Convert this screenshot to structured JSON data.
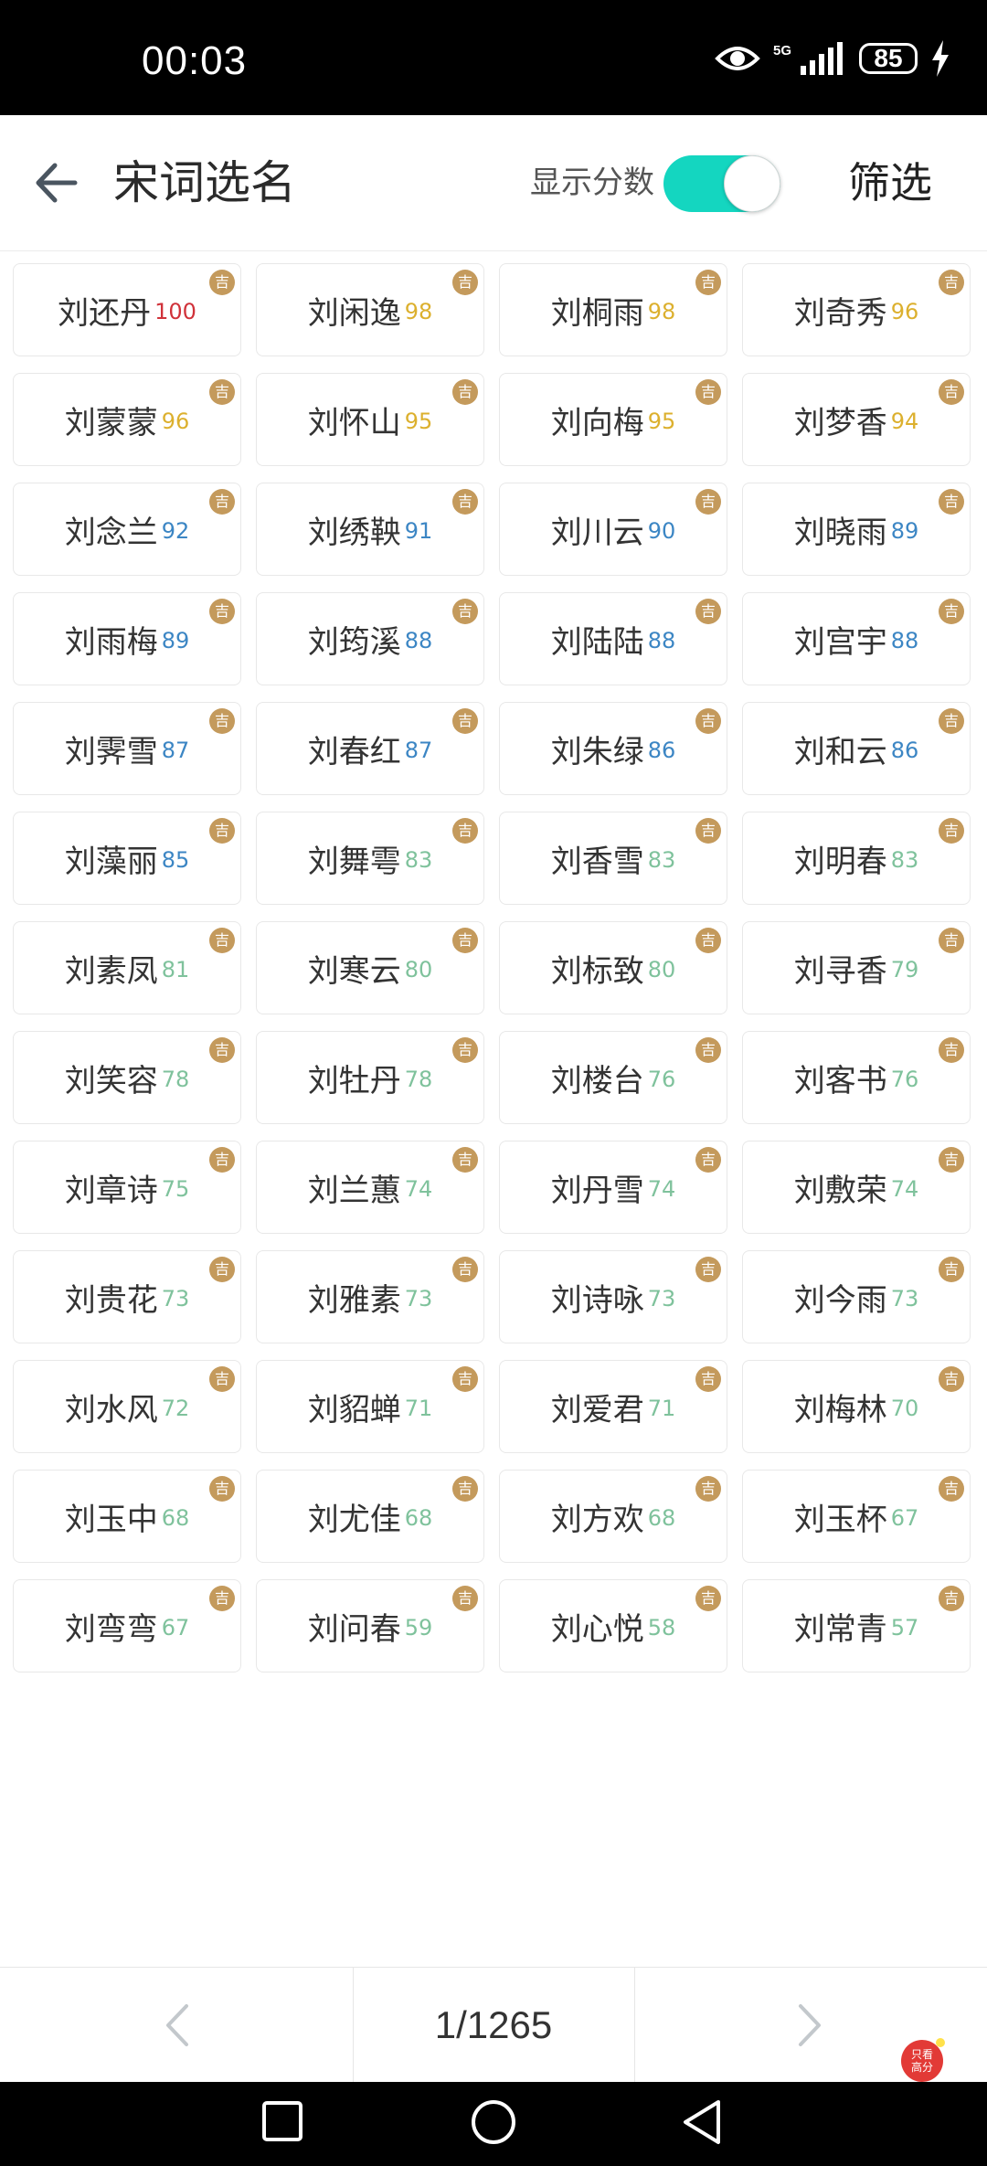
{
  "status_bar": {
    "time": "00:03",
    "network": "5G",
    "battery": "85"
  },
  "header": {
    "title": "宋词选名",
    "toggle_label": "显示分数",
    "toggle_on": true,
    "filter_label": "筛选"
  },
  "badge_text": "吉",
  "colors": {
    "accent_toggle": "#14d6c0",
    "score_red": "#d0323a",
    "score_gold": "#dcb02e",
    "score_blue": "#3c86c4",
    "score_green": "#7fc29c",
    "badge": "#c49a5c"
  },
  "names": [
    {
      "name": "刘还丹",
      "score": "100",
      "tier": "red"
    },
    {
      "name": "刘闲逸",
      "score": "98",
      "tier": "gold"
    },
    {
      "name": "刘桐雨",
      "score": "98",
      "tier": "gold"
    },
    {
      "name": "刘奇秀",
      "score": "96",
      "tier": "gold"
    },
    {
      "name": "刘蒙蒙",
      "score": "96",
      "tier": "gold"
    },
    {
      "name": "刘怀山",
      "score": "95",
      "tier": "gold"
    },
    {
      "name": "刘向梅",
      "score": "95",
      "tier": "gold"
    },
    {
      "name": "刘梦香",
      "score": "94",
      "tier": "gold"
    },
    {
      "name": "刘念兰",
      "score": "92",
      "tier": "blue"
    },
    {
      "name": "刘绣鞅",
      "score": "91",
      "tier": "blue"
    },
    {
      "name": "刘川云",
      "score": "90",
      "tier": "blue"
    },
    {
      "name": "刘晓雨",
      "score": "89",
      "tier": "blue"
    },
    {
      "name": "刘雨梅",
      "score": "89",
      "tier": "blue"
    },
    {
      "name": "刘筠溪",
      "score": "88",
      "tier": "blue"
    },
    {
      "name": "刘陆陆",
      "score": "88",
      "tier": "blue"
    },
    {
      "name": "刘宫宇",
      "score": "88",
      "tier": "blue"
    },
    {
      "name": "刘霁雪",
      "score": "87",
      "tier": "blue"
    },
    {
      "name": "刘春红",
      "score": "87",
      "tier": "blue"
    },
    {
      "name": "刘朱绿",
      "score": "86",
      "tier": "blue"
    },
    {
      "name": "刘和云",
      "score": "86",
      "tier": "blue"
    },
    {
      "name": "刘藻丽",
      "score": "85",
      "tier": "blue"
    },
    {
      "name": "刘舞雩",
      "score": "83",
      "tier": "green"
    },
    {
      "name": "刘香雪",
      "score": "83",
      "tier": "green"
    },
    {
      "name": "刘明春",
      "score": "83",
      "tier": "green"
    },
    {
      "name": "刘素凤",
      "score": "81",
      "tier": "green"
    },
    {
      "name": "刘寒云",
      "score": "80",
      "tier": "green"
    },
    {
      "name": "刘标致",
      "score": "80",
      "tier": "green"
    },
    {
      "name": "刘寻香",
      "score": "79",
      "tier": "green"
    },
    {
      "name": "刘笑容",
      "score": "78",
      "tier": "green"
    },
    {
      "name": "刘牡丹",
      "score": "78",
      "tier": "green"
    },
    {
      "name": "刘楼台",
      "score": "76",
      "tier": "green"
    },
    {
      "name": "刘客书",
      "score": "76",
      "tier": "green"
    },
    {
      "name": "刘章诗",
      "score": "75",
      "tier": "green"
    },
    {
      "name": "刘兰蕙",
      "score": "74",
      "tier": "green"
    },
    {
      "name": "刘丹雪",
      "score": "74",
      "tier": "green"
    },
    {
      "name": "刘敷荣",
      "score": "74",
      "tier": "green"
    },
    {
      "name": "刘贵花",
      "score": "73",
      "tier": "green"
    },
    {
      "name": "刘雅素",
      "score": "73",
      "tier": "green"
    },
    {
      "name": "刘诗咏",
      "score": "73",
      "tier": "green"
    },
    {
      "name": "刘今雨",
      "score": "73",
      "tier": "green"
    },
    {
      "name": "刘水风",
      "score": "72",
      "tier": "green"
    },
    {
      "name": "刘貂蝉",
      "score": "71",
      "tier": "green"
    },
    {
      "name": "刘爱君",
      "score": "71",
      "tier": "green"
    },
    {
      "name": "刘梅林",
      "score": "70",
      "tier": "green"
    },
    {
      "name": "刘玉中",
      "score": "68",
      "tier": "green"
    },
    {
      "name": "刘尤佳",
      "score": "68",
      "tier": "green"
    },
    {
      "name": "刘方欢",
      "score": "68",
      "tier": "green"
    },
    {
      "name": "刘玉杯",
      "score": "67",
      "tier": "green"
    },
    {
      "name": "刘弯弯",
      "score": "67",
      "tier": "green"
    },
    {
      "name": "刘问春",
      "score": "59",
      "tier": "green"
    },
    {
      "name": "刘心悦",
      "score": "58",
      "tier": "green"
    },
    {
      "name": "刘常青",
      "score": "57",
      "tier": "green"
    }
  ],
  "pager": {
    "indicator": "1/1265"
  },
  "floating_button": {
    "text": "只看\n高分"
  }
}
